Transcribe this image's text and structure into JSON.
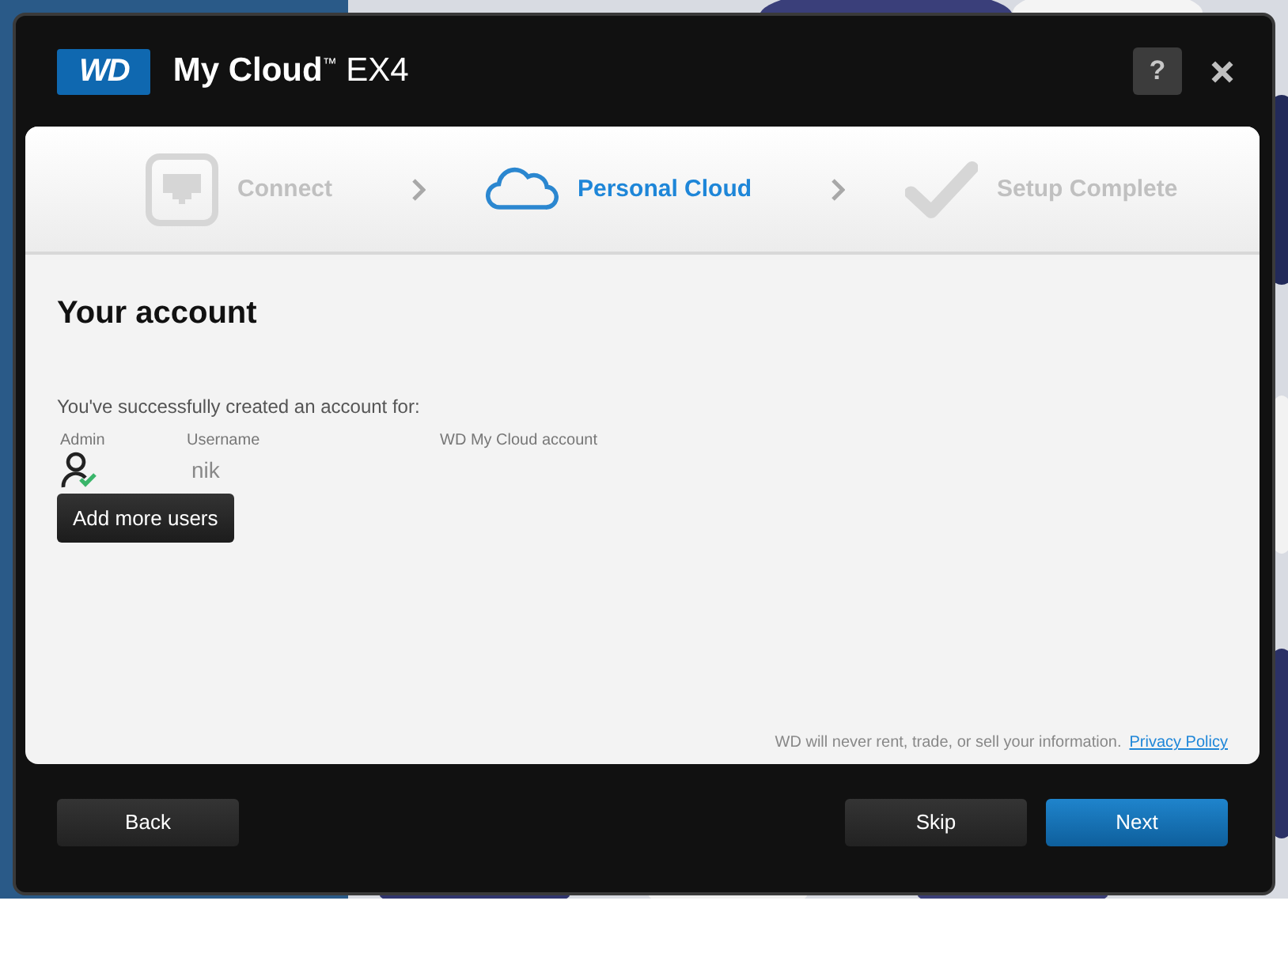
{
  "window": {
    "logo": "WD",
    "title": "**My Cloud**$^{™}$ EX4",
    "help": "?"
  },
  "steps": [
    {
      "label": "Connect",
      "kind": "connect",
      "selected": false
    },
    {
      "label": "Personal Cloud",
      "kind": "cloud",
      "selected": true
    },
    {
      "label": "Setup Complete",
      "kind": "complete",
      "selected": false
    }
  ],
  "account": {
    "heading": "Your account",
    "intro": "You've successfully created an account for:",
    "columns": [
      "Admin",
      "Username",
      "WD My Cloud account"
    ],
    "rows": [
      {
        "admin": true,
        "username": "nik"
      }
    ],
    "add_button": "Add more users"
  },
  "privacy": {
    "note": "WD will never rent, trade, or sell your information.",
    "link": "Privacy Policy"
  },
  "buttons": [
    {
      "label": "Back",
      "kind": "secondary"
    },
    {
      "label": "Skip",
      "kind": "secondary"
    },
    {
      "label": "Next",
      "kind": "primary"
    }
  ]
}
